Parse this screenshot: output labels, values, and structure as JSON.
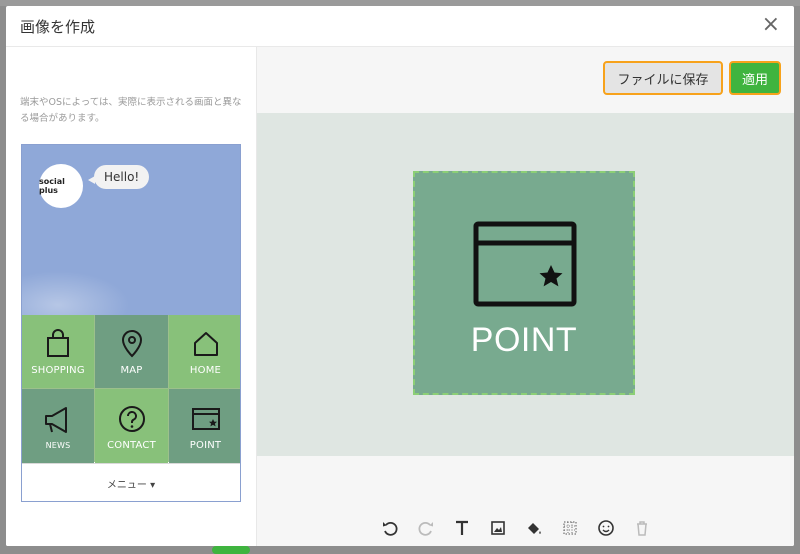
{
  "modal": {
    "title": "画像を作成",
    "close_symbol": "×"
  },
  "notice": "端末やOSによっては、実際に表示される画面と異なる場合があります。",
  "preview": {
    "logo_text": "social plus",
    "greeting": "Hello!",
    "tiles": [
      {
        "label": "SHOPPING",
        "icon": "shopping-bag-icon",
        "tone": "light"
      },
      {
        "label": "MAP",
        "icon": "map-pin-icon",
        "tone": "dark"
      },
      {
        "label": "HOME",
        "icon": "home-icon",
        "tone": "light"
      },
      {
        "label": "NEWS",
        "icon": "megaphone-icon",
        "tone": "dark"
      },
      {
        "label": "CONTACT",
        "icon": "question-icon",
        "tone": "light"
      },
      {
        "label": "POINT",
        "icon": "point-card-icon",
        "tone": "dark"
      }
    ],
    "menu_label": "メニュー ▾"
  },
  "actions": {
    "save_label": "ファイルに保存",
    "apply_label": "適用"
  },
  "editor": {
    "tile_label": "POINT",
    "tile_icon": "point-card-icon",
    "tile_color": "#78aa8f"
  },
  "toolbar": {
    "tools": [
      "undo-icon",
      "redo-icon",
      "text-icon",
      "image-icon",
      "fill-icon",
      "grid-icon",
      "emoji-icon",
      "trash-icon"
    ]
  },
  "colors": {
    "accent_orange": "#f7a21b",
    "apply_green": "#3fb43f",
    "phone_sky": "#8fa8d8"
  }
}
